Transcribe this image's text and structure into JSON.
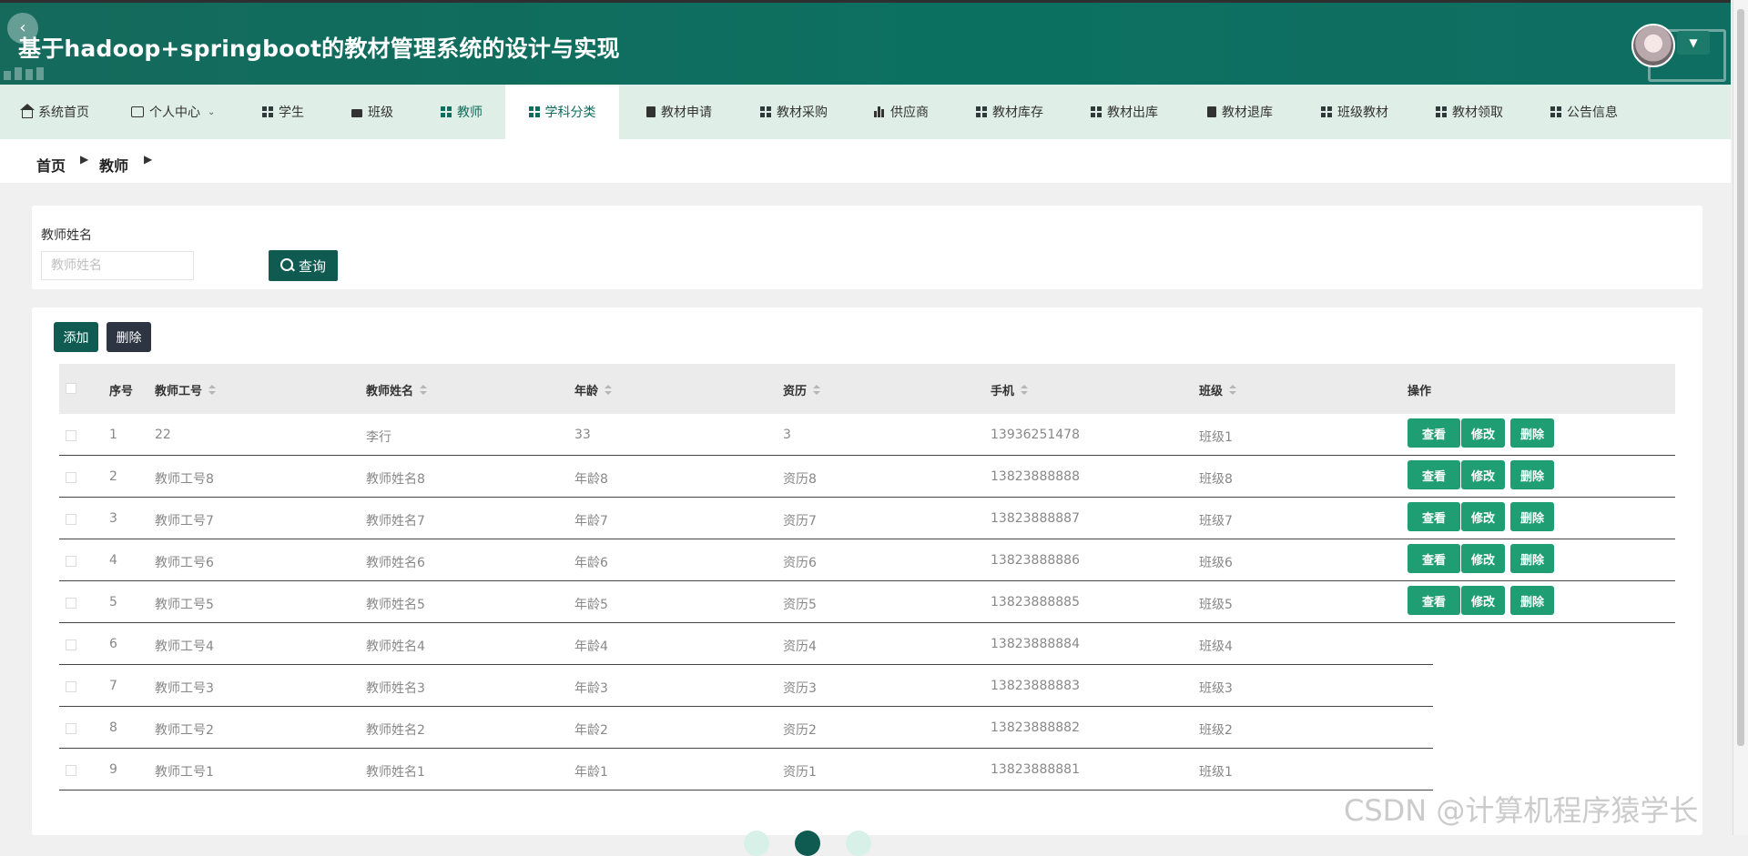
{
  "app": {
    "title": "基于hadoop+springboot的教材管理系统的设计与实现"
  },
  "nav": {
    "items": [
      {
        "label": "系统首页",
        "icon": "home-icon"
      },
      {
        "label": "个人中心",
        "icon": "card-icon"
      },
      {
        "label": "学生",
        "icon": "grid-icon"
      },
      {
        "label": "班级",
        "icon": "folder-icon"
      },
      {
        "label": "教师",
        "icon": "grid-icon"
      },
      {
        "label": "学科分类",
        "icon": "grid-icon"
      },
      {
        "label": "教材申请",
        "icon": "clipboard-icon"
      },
      {
        "label": "教材采购",
        "icon": "grid-icon"
      },
      {
        "label": "供应商",
        "icon": "bar-chart-icon"
      },
      {
        "label": "教材库存",
        "icon": "grid-icon"
      },
      {
        "label": "教材出库",
        "icon": "grid-icon"
      },
      {
        "label": "教材退库",
        "icon": "clipboard-icon"
      },
      {
        "label": "班级教材",
        "icon": "grid-icon"
      },
      {
        "label": "教材领取",
        "icon": "grid-icon"
      },
      {
        "label": "公告信息",
        "icon": "grid-icon"
      }
    ],
    "active": "学科分类"
  },
  "breadcrumb": {
    "home": "首页",
    "current": "教师"
  },
  "search": {
    "label": "教师姓名",
    "placeholder": "教师姓名",
    "button": "查询"
  },
  "toolbar": {
    "add": "添加",
    "delete": "删除"
  },
  "table": {
    "columns": [
      "序号",
      "教师工号",
      "教师姓名",
      "年龄",
      "资历",
      "手机",
      "班级",
      "操作"
    ],
    "rows": [
      [
        "1",
        "22",
        "李行",
        "33",
        "3",
        "13936251478",
        "班级1"
      ],
      [
        "2",
        "教师工号8",
        "教师姓名8",
        "年龄8",
        "资历8",
        "13823888888",
        "班级8"
      ],
      [
        "3",
        "教师工号7",
        "教师姓名7",
        "年龄7",
        "资历7",
        "13823888887",
        "班级7"
      ],
      [
        "4",
        "教师工号6",
        "教师姓名6",
        "年龄6",
        "资历6",
        "13823888886",
        "班级6"
      ],
      [
        "5",
        "教师工号5",
        "教师姓名5",
        "年龄5",
        "资历5",
        "13823888885",
        "班级5"
      ],
      [
        "6",
        "教师工号4",
        "教师姓名4",
        "年龄4",
        "资历4",
        "13823888884",
        "班级4"
      ],
      [
        "7",
        "教师工号3",
        "教师姓名3",
        "年龄3",
        "资历3",
        "13823888883",
        "班级3"
      ],
      [
        "8",
        "教师工号2",
        "教师姓名2",
        "年龄2",
        "资历2",
        "13823888882",
        "班级2"
      ],
      [
        "9",
        "教师工号1",
        "教师姓名1",
        "年龄1",
        "资历1",
        "13823888881",
        "班级1"
      ]
    ],
    "actions": [
      "查看",
      "修改",
      "删除"
    ]
  },
  "watermark": "CSDN @计算机程序猿学长",
  "colors": {
    "header": "#0c7060",
    "nav_bg": "#dfeee7",
    "primary_button": "#0f5b52",
    "action_button": "#1e9e72",
    "delete_button": "#2c3541"
  }
}
